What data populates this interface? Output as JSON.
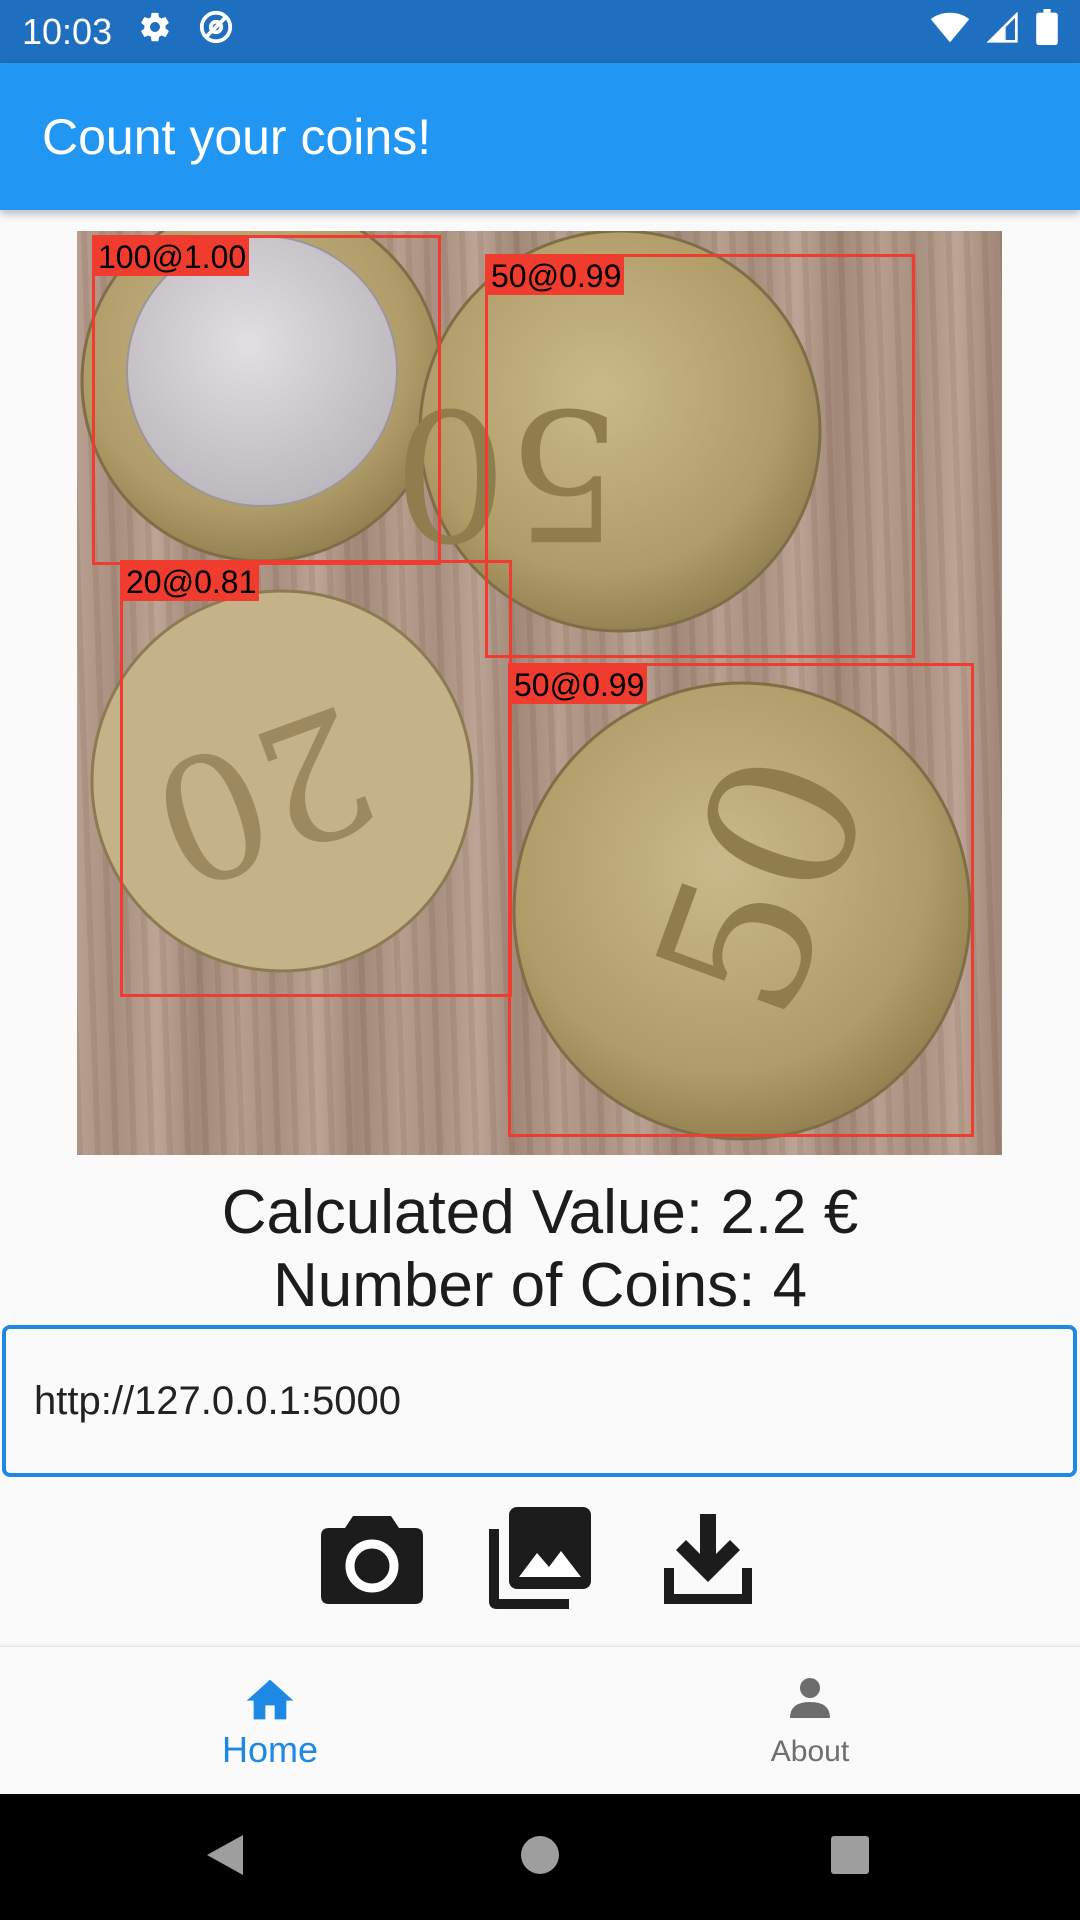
{
  "status_bar": {
    "time": "10:03",
    "left_icons": [
      "gear-icon",
      "at-sign-icon"
    ],
    "right_icons": [
      "wifi-icon",
      "signal-icon",
      "battery-icon"
    ]
  },
  "app_bar": {
    "title": "Count your coins!"
  },
  "detections": [
    {
      "label": "100@1.00"
    },
    {
      "label": "50@0.99"
    },
    {
      "label": "20@0.81"
    },
    {
      "label": "50@0.99"
    }
  ],
  "results": {
    "value_text": "Calculated Value: 2.2 €",
    "count_text": "Number of Coins: 4"
  },
  "server_url": {
    "value": "http://127.0.0.1:5000"
  },
  "actions": [
    "camera-icon",
    "gallery-icon",
    "download-icon"
  ],
  "bottom_nav": {
    "items": [
      {
        "label": "Home",
        "icon": "home-icon",
        "active": true
      },
      {
        "label": "About",
        "icon": "person-icon",
        "active": false
      }
    ]
  },
  "system_nav": [
    "back-icon",
    "home-circle-icon",
    "recents-icon"
  ],
  "colors": {
    "status_bar": "#1e6fbf",
    "app_bar": "#2196f3",
    "accent": "#1e88e5",
    "detection": "#f03c2e"
  }
}
